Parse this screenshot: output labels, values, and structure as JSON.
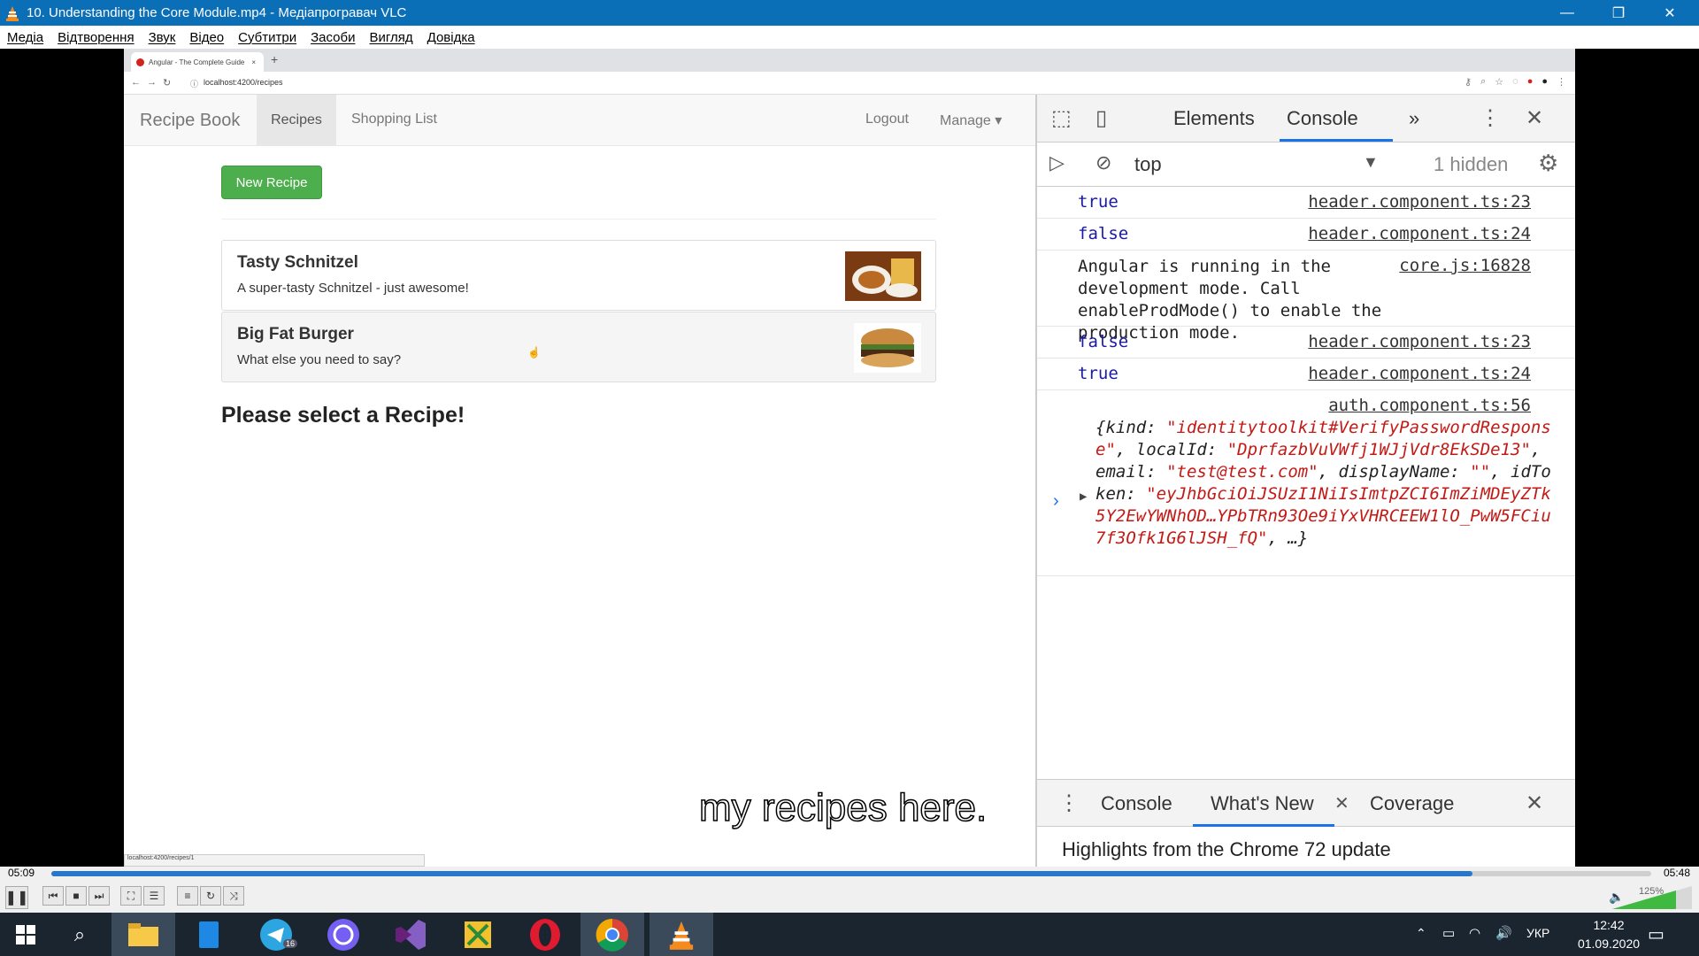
{
  "window": {
    "title": "10. Understanding the Core Module.mp4 - Медіапрогравач VLC",
    "minimize": "—",
    "restore": "❐",
    "close": "✕"
  },
  "menu": [
    "Медіа",
    "Відтворення",
    "Звук",
    "Відео",
    "Субтитри",
    "Засоби",
    "Вигляд",
    "Довідка"
  ],
  "browser": {
    "tab_title": "Angular - The Complete Guide",
    "tab_close": "×",
    "new_tab": "+",
    "url": "localhost:4200/recipes",
    "status_url": "localhost:4200/recipes/1"
  },
  "app": {
    "brand": "Recipe Book",
    "nav_recipes": "Recipes",
    "nav_shopping": "Shopping List",
    "nav_logout": "Logout",
    "nav_manage": "Manage ▾",
    "new_recipe": "New Recipe",
    "recipes": [
      {
        "name": "Tasty Schnitzel",
        "description": "A super-tasty Schnitzel - just awesome!"
      },
      {
        "name": "Big Fat Burger",
        "description": "What else you need to say?"
      }
    ],
    "select_message": "Please select a Recipe!"
  },
  "devtools": {
    "tab_elements": "Elements",
    "tab_console": "Console",
    "more_tabs": "»",
    "context": "top",
    "hidden": "1 hidden",
    "logs": [
      {
        "value": "true",
        "source": "header.component.ts:23"
      },
      {
        "value": "false",
        "source": "header.component.ts:24"
      },
      {
        "message": "Angular is running in the development mode. Call enableProdMode() to enable the production mode.",
        "source": "core.js:16828"
      },
      {
        "value": "false",
        "source": "header.component.ts:23"
      },
      {
        "value": "true",
        "source": "header.component.ts:24"
      },
      {
        "source": "auth.component.ts:56"
      }
    ],
    "object": {
      "p1": "{kind: ",
      "kind": "\"identitytoolkit#VerifyPasswordResponse\"",
      "p2": ", localId: ",
      "localId": "\"DprfazbVuVWfj1WJjVdr8EkSDe13\"",
      "p3": ", email: ",
      "email": "\"test@test.com\"",
      "p4": ", displayName: ",
      "displayName": "\"\"",
      "p5": ", idToken: ",
      "idToken": "\"eyJhbGciOiJSUzI1NiIsImtpZCI6ImZiMDEyZTk5Y2EwYWNhOD…YPbTRn93Oe9iYxVHRCEEW1lO_PwW5FCiu7f3Ofk1G6lJSH_fQ\"",
      "p6": ", …}"
    },
    "prompt": "›",
    "drawer_console": "Console",
    "drawer_whatsnew": "What's New",
    "drawer_coverage": "Coverage",
    "highlights": "Highlights from the Chrome 72 update"
  },
  "subtitle": "my recipes here.",
  "player": {
    "elapsed": "05:09",
    "total": "05:48",
    "progress": 0.888,
    "volume_label": "125%"
  },
  "taskbar": {
    "lang": "УКР",
    "time": "12:42",
    "date": "01.09.2020",
    "telegram_badge": "16"
  },
  "colors": {
    "vlc_blue": "#0b6fb8",
    "bootstrap_success": "#5cb85c",
    "devtools_blue": "#1a73e8"
  }
}
